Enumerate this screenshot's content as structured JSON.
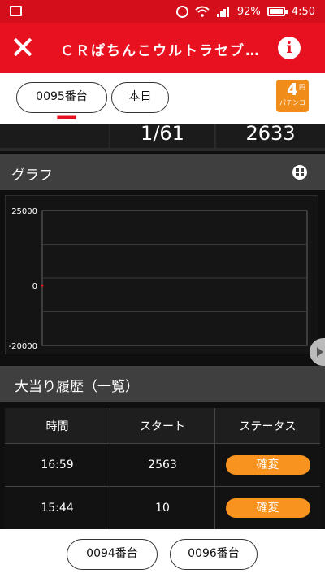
{
  "statusbar": {
    "battery": "92%",
    "time": "4:50",
    "icons": [
      "gallery-icon",
      "alarm-icon",
      "wifi-icon",
      "signal-icon",
      "battery-icon"
    ]
  },
  "header": {
    "title": "ＣＲぱちんこウルトラセブン...",
    "close_icon": "close-icon",
    "info_glyph": "i"
  },
  "selector": {
    "machine": "0095番台",
    "day": "本日",
    "badge_number": "4",
    "badge_unit": "円",
    "badge_type": "パチンコ"
  },
  "stats": {
    "cut_value": "ー",
    "probability": "1/61",
    "total": "2633"
  },
  "graph": {
    "label": "グラフ",
    "icon": "grid-icon"
  },
  "chart_data": {
    "type": "line",
    "ylim": [
      -20000,
      25000
    ],
    "yticks": [
      "25000",
      "0",
      "-20000"
    ],
    "series": [
      {
        "values": [
          0
        ]
      }
    ],
    "grid": true
  },
  "history": {
    "label": "大当り履歴（一覧）",
    "columns": [
      "時間",
      "スタート",
      "ステータス"
    ],
    "rows": [
      {
        "time": "16:59",
        "start": "2563",
        "status": "確変"
      },
      {
        "time": "15:44",
        "start": "10",
        "status": "確変"
      }
    ]
  },
  "nav": {
    "prev": "0094番台",
    "next": "0096番台"
  },
  "colors": {
    "header": "#e8111f",
    "status_pill": "#f7931e",
    "badge": "#f08c1a"
  }
}
